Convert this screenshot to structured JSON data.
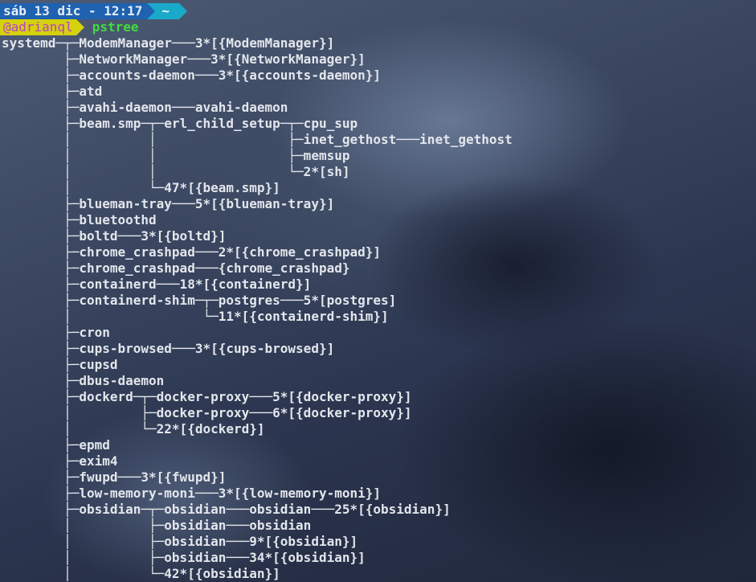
{
  "prompt": {
    "date_segment": "sáb 13 dic - 12:17",
    "dir_segment": "~",
    "user_segment": "@adrianql",
    "command": "pstree"
  },
  "tree_lines": [
    "systemd─┬─ModemManager───3*[{ModemManager}]",
    "        ├─NetworkManager───3*[{NetworkManager}]",
    "        ├─accounts-daemon───3*[{accounts-daemon}]",
    "        ├─atd",
    "        ├─avahi-daemon───avahi-daemon",
    "        ├─beam.smp─┬─erl_child_setup─┬─cpu_sup",
    "        │          │                 ├─inet_gethost───inet_gethost",
    "        │          │                 ├─memsup",
    "        │          │                 └─2*[sh]",
    "        │          └─47*[{beam.smp}]",
    "        ├─blueman-tray───5*[{blueman-tray}]",
    "        ├─bluetoothd",
    "        ├─boltd───3*[{boltd}]",
    "        ├─chrome_crashpad───2*[{chrome_crashpad}]",
    "        ├─chrome_crashpad───{chrome_crashpad}",
    "        ├─containerd───18*[{containerd}]",
    "        ├─containerd-shim─┬─postgres───5*[postgres]",
    "        │                 └─11*[{containerd-shim}]",
    "        ├─cron",
    "        ├─cups-browsed───3*[{cups-browsed}]",
    "        ├─cupsd",
    "        ├─dbus-daemon",
    "        ├─dockerd─┬─docker-proxy───5*[{docker-proxy}]",
    "        │         ├─docker-proxy───6*[{docker-proxy}]",
    "        │         └─22*[{dockerd}]",
    "        ├─epmd",
    "        ├─exim4",
    "        ├─fwupd───3*[{fwupd}]",
    "        ├─low-memory-moni───3*[{low-memory-moni}]",
    "        ├─obsidian─┬─obsidian───obsidian───25*[{obsidian}]",
    "        │          ├─obsidian───obsidian",
    "        │          ├─obsidian───9*[{obsidian}]",
    "        │          ├─obsidian───34*[{obsidian}]",
    "        │          └─42*[{obsidian}]"
  ],
  "colors": {
    "date_bg": "#1e62b0",
    "dir_bg": "#19a9c9",
    "user_bg": "#d5d10f",
    "user_fg": "#b543c8",
    "command_fg": "#3fdc3f",
    "output_fg": "#e3e6ec"
  }
}
